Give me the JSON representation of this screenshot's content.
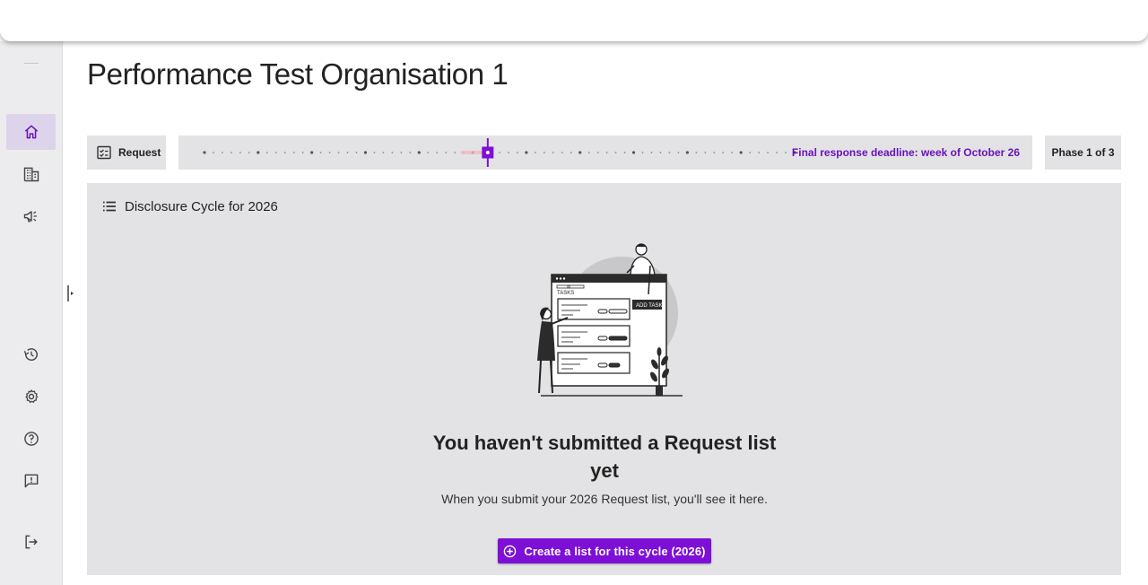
{
  "page": {
    "title": "Performance Test Organisation 1"
  },
  "sidebar": {
    "items": [
      {
        "icon": "home-icon",
        "active": true
      },
      {
        "icon": "building-icon",
        "active": false
      },
      {
        "icon": "megaphone-icon",
        "active": false
      },
      {
        "icon": "history-icon",
        "active": false
      },
      {
        "icon": "gear-icon",
        "active": false
      },
      {
        "icon": "help-icon",
        "active": false
      },
      {
        "icon": "feedback-icon",
        "active": false
      },
      {
        "icon": "logout-icon",
        "active": false
      }
    ]
  },
  "phase_bar": {
    "request_label": "Request",
    "deadline_text": "Final response deadline: week of October 26",
    "phase_label": "Phase 1 of 3",
    "progress_fraction": 0.48
  },
  "panel": {
    "title": "Disclosure Cycle for 2026",
    "empty_title": "You haven't submitted a Request list yet",
    "empty_subtitle": "When you submit your 2026 Request list, you'll see it here.",
    "create_button": "Create a list for this cycle (2026)",
    "illustration": {
      "tasks_label": "TASKS",
      "add_task_label": "ADD TASK"
    }
  },
  "colors": {
    "accent": "#7d0fd6",
    "deadline_text": "#6a12b8",
    "sidebar_bg": "#ececee",
    "sidebar_active": "#ddd3ea",
    "panel_bg": "#e3e3e5"
  }
}
